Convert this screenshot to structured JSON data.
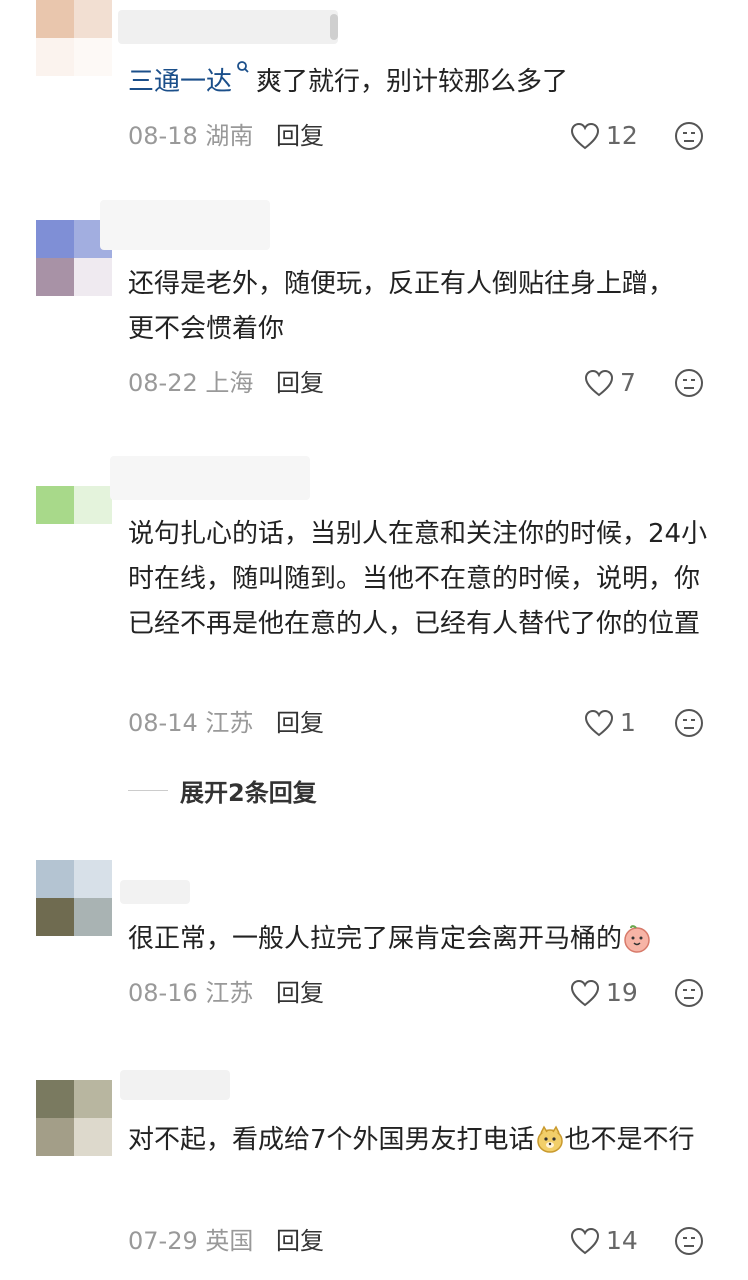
{
  "comments": [
    {
      "username": "三通一达",
      "text": "爽了就行，别计较那么多了",
      "date": "08-18",
      "location": "湖南",
      "reply_label": "回复",
      "likes": "12"
    },
    {
      "text": "还得是老外，随便玩，反正有人倒贴往身上蹭，更不会惯着你",
      "date": "08-22",
      "location": "上海",
      "reply_label": "回复",
      "likes": "7"
    },
    {
      "text": "说句扎心的话，当别人在意和关注你的时候，24小时在线，随叫随到。当他不在意的时候，说明，你已经不再是他在意的人，已经有人替代了你的位置",
      "date": "08-14",
      "location": "江苏",
      "reply_label": "回复",
      "likes": "1"
    },
    {
      "text": "很正常，一般人拉完了屎肯定会离开马桶的",
      "date": "08-16",
      "location": "江苏",
      "reply_label": "回复",
      "likes": "19"
    },
    {
      "text_a": "对不起，看成给7个外国男友打电话",
      "text_b": "也不是不行",
      "date": "07-29",
      "location": "英国",
      "reply_label": "回复",
      "likes": "14"
    }
  ],
  "expand_replies": "展开2条回复",
  "icons": {
    "like": "heart-outline-icon",
    "dislike": "neutral-face-icon",
    "verified": "search-badge-icon",
    "emoji_peach": "peach-emoji",
    "emoji_doge": "doge-emoji"
  },
  "colors": {
    "username": "#1b4f8a",
    "meta": "#999999",
    "text": "#222222"
  }
}
